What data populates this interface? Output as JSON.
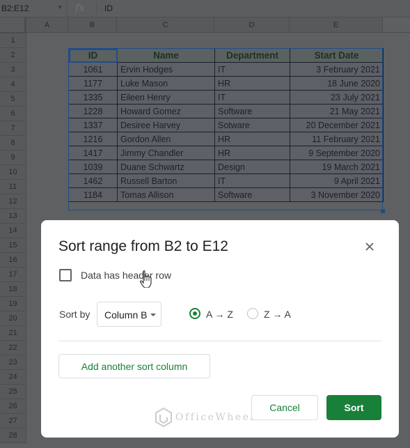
{
  "formula_bar": {
    "name_box": "B2:E12",
    "fx_icon": "fx-icon",
    "value": "ID"
  },
  "grid": {
    "columns": [
      "A",
      "B",
      "C",
      "D",
      "E"
    ],
    "rows": [
      "1",
      "2",
      "3",
      "4",
      "5",
      "6",
      "7",
      "8",
      "9",
      "10",
      "11",
      "12",
      "13",
      "14",
      "15",
      "16",
      "17",
      "18",
      "19",
      "20",
      "21",
      "22",
      "23",
      "24",
      "25",
      "26",
      "27",
      "28"
    ]
  },
  "table": {
    "headers": [
      "ID",
      "Name",
      "Department",
      "Start Date"
    ],
    "rows": [
      [
        "1061",
        "Ervin Hodges",
        "IT",
        "3 February 2021"
      ],
      [
        "1177",
        "Luke Mason",
        "HR",
        "18 June 2020"
      ],
      [
        "1335",
        "Eileen Henry",
        "IT",
        "23 July 2021"
      ],
      [
        "1228",
        "Howard Gomez",
        "Software",
        "21 May 2021"
      ],
      [
        "1337",
        "Desiree Harvey",
        "Sotware",
        "20 December 2021"
      ],
      [
        "1216",
        "Gordon Allen",
        "HR",
        "11 February 2021"
      ],
      [
        "1417",
        "Jimmy Chandler",
        "HR",
        "9 September 2020"
      ],
      [
        "1039",
        "Duane Schwartz",
        "Design",
        "19 March 2021"
      ],
      [
        "1462",
        "Russell Barton",
        "IT",
        "9 April 2021"
      ],
      [
        "1184",
        "Tomas Allison",
        "Software",
        "3 November 2020"
      ]
    ]
  },
  "dialog": {
    "title": "Sort range from B2 to E12",
    "close_icon": "close-icon",
    "header_checkbox_label": "Data has header row",
    "header_checkbox_checked": false,
    "sort_by_label": "Sort by",
    "sort_column": "Column B",
    "order_options": [
      {
        "label": "A → Z",
        "selected": true
      },
      {
        "label": "Z → A",
        "selected": false
      }
    ],
    "add_column_label": "Add another sort column",
    "cancel_label": "Cancel",
    "sort_label": "Sort",
    "accent_color": "#188038"
  },
  "watermark": {
    "text": "OfficeWheel"
  }
}
